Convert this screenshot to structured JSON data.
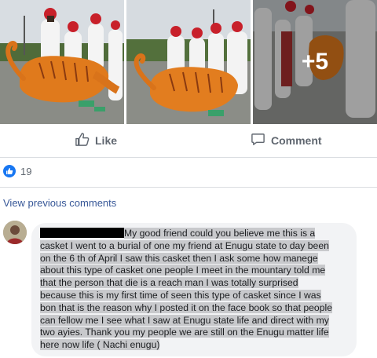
{
  "post": {
    "photos": [
      {
        "name": "casket-photo-1"
      },
      {
        "name": "casket-photo-2"
      },
      {
        "name": "casket-photo-3",
        "more_count": "+5"
      }
    ],
    "actions": {
      "like_label": "Like",
      "comment_label": "Comment"
    },
    "reactions": {
      "count": "19",
      "icon": "thumbs-up-icon",
      "color": "#1877f2"
    },
    "view_previous_label": "View previous comments"
  },
  "comment": {
    "text": "My good friend could you believe me this is a casket I went to a burial of one my friend at Enugu state to day been on the 6 th of April I saw this casket then I ask some how manege about this type of casket one people I meet in the mountary told me that the person that die is a reach man I was totally surprised because this is my first time of seen this type of casket since I was bon that is the reason why I posted it on the face book so that people can fellow me I see what I saw at Enugu state life and direct with my two ayies. Thank you my people we are still on the Enugu matter life here now life ( Nachi enugu)"
  },
  "colors": {
    "link": "#385898",
    "action_text": "#606770",
    "bubble_bg": "#f2f3f5",
    "highlight": "#c8c9cc"
  }
}
